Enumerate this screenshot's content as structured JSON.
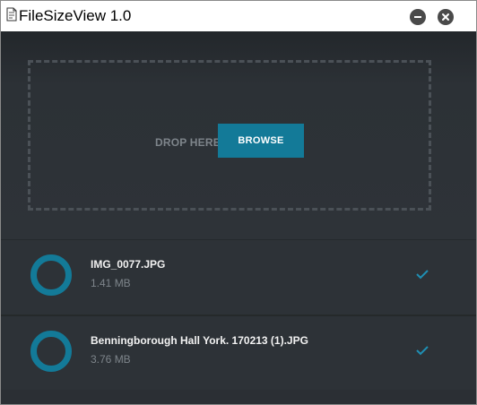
{
  "window": {
    "title": "FileSizeView 1.0",
    "icons": {
      "app": "document-icon",
      "minimize": "minimize-icon",
      "close": "close-icon"
    }
  },
  "dropzone": {
    "label": "DROP HERE",
    "browse_label": "BROWSE"
  },
  "files": [
    {
      "name": "IMG_0077.JPG",
      "size": "1.41 MB",
      "icon": "circle-ring-icon",
      "status_icon": "checkmark-icon"
    },
    {
      "name": "Benningborough Hall York. 170213 (1).JPG",
      "size": "3.76 MB",
      "icon": "circle-ring-icon",
      "status_icon": "checkmark-icon"
    }
  ],
  "colors": {
    "accent": "#137a98",
    "background": "#2b2f34",
    "muted_text": "#7e858b"
  }
}
